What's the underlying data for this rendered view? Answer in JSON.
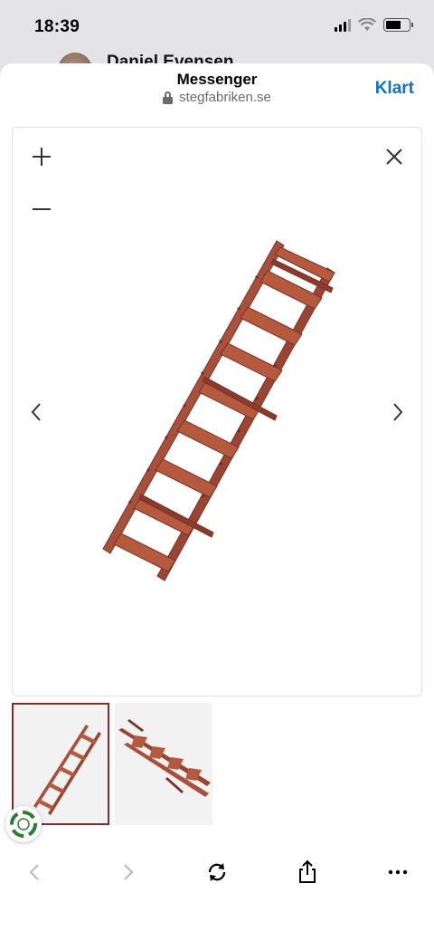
{
  "status_bar": {
    "time": "18:39",
    "battery_level": 0.65
  },
  "behind": {
    "contact_name": "Daniel Evensen"
  },
  "sheet": {
    "title": "Messenger",
    "url": "stegfabriken.se",
    "done_label": "Klart"
  },
  "viewer": {
    "controls": [
      "plus-icon",
      "minus-icon",
      "close-icon",
      "chevron-left-icon",
      "chevron-right-icon"
    ],
    "thumbnails_count": 2,
    "active_thumbnail": 1
  },
  "toolbar": {
    "icons": [
      "chevron-left-icon",
      "chevron-right-icon",
      "reload-icon",
      "share-icon",
      "ellipsis-icon"
    ]
  },
  "colors": {
    "accent": "#1670c4",
    "ladder": "#a9503c",
    "active_thumb_border": "#8a2b2b"
  }
}
